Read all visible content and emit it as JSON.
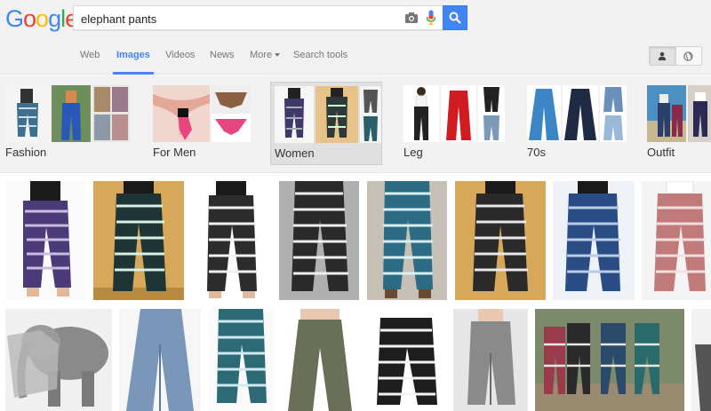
{
  "logo": {
    "letters": [
      "G",
      "o",
      "o",
      "g",
      "l",
      "e"
    ],
    "colors": [
      "#4285f4",
      "#ea4335",
      "#fbbc05",
      "#4285f4",
      "#34a853",
      "#ea4335"
    ]
  },
  "search": {
    "query": "elephant pants"
  },
  "tabs": [
    {
      "label": "Web"
    },
    {
      "label": "Images",
      "active": true
    },
    {
      "label": "Videos"
    },
    {
      "label": "News"
    },
    {
      "label": "More"
    },
    {
      "label": "Search tools"
    }
  ],
  "safe_toggle": {
    "left_icon": "person-icon",
    "right_icon": "globe-icon"
  },
  "related": [
    {
      "label": "Fashion"
    },
    {
      "label": "For Men"
    },
    {
      "label": "Women",
      "selected": true
    },
    {
      "label": "Leg"
    },
    {
      "label": "70s"
    },
    {
      "label": "Outfit"
    }
  ],
  "colors": {
    "accent": "#4285f4",
    "strip_bg": "#f1f1f1"
  }
}
